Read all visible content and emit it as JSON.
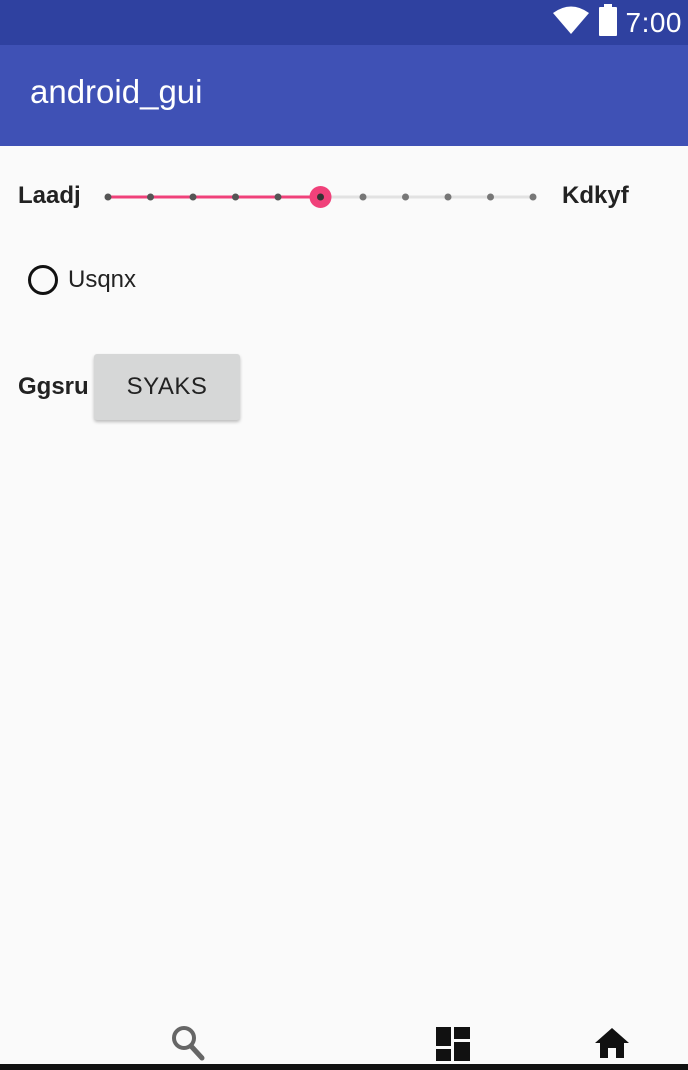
{
  "status_bar": {
    "time": "7:00",
    "icons": [
      "wifi-icon",
      "battery-icon"
    ],
    "background": "#2f41a0"
  },
  "app_bar": {
    "title": "android_gui",
    "background": "#3f51b5"
  },
  "seekbar": {
    "start_label": "Laadj",
    "end_label": "Kdkyf",
    "steps": 10,
    "value": 5,
    "accent": "#f0417a"
  },
  "radio": {
    "label": "Usqnx",
    "checked": false
  },
  "button_row": {
    "label": "Ggsru",
    "button_label": "SYAKS"
  },
  "bottom_nav": {
    "icons": [
      "search-icon",
      "dashboard-icon",
      "home-icon"
    ]
  }
}
